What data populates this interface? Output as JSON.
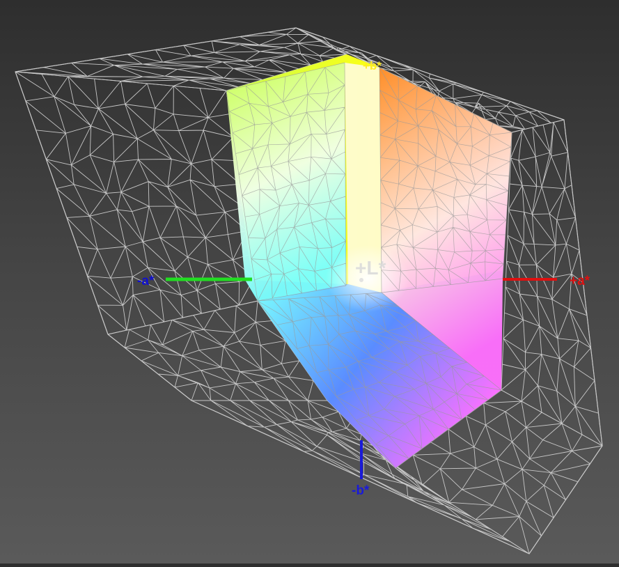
{
  "axes": {
    "plus_L": {
      "label": "+L*",
      "color": "#d9d9d9"
    },
    "minus_a": {
      "label": "-a*",
      "color": "#1010d0",
      "line_color": "#22dd22"
    },
    "plus_a": {
      "label": "+a*",
      "color": "#e01010",
      "line_color": "#e01010"
    },
    "minus_b": {
      "label": "-b*",
      "color": "#1a1ad8",
      "line_color": "#1a1ad8"
    },
    "plus_b": {
      "label": "+b*",
      "color": "#ffee22"
    }
  },
  "colors": {
    "wireframe": "#c8c8c8",
    "solid_mesh": "#9a9a9a",
    "yellow": "#ffff10",
    "orange": "#ff8a2a",
    "green_yellow": "#c8ff50",
    "cyan": "#7affff",
    "blue": "#5a8cff",
    "magenta": "#ff70ff",
    "white": "#ffffff"
  }
}
